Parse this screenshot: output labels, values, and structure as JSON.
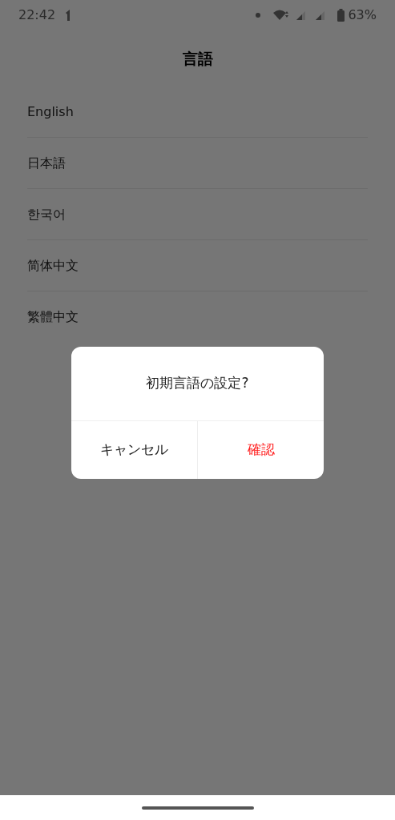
{
  "status_bar": {
    "time": "22:42",
    "battery": "63%"
  },
  "title": "言語",
  "languages": [
    "English",
    "日本語",
    "한국어",
    "简体中文",
    "繁體中文"
  ],
  "dialog": {
    "message": "初期言語の設定?",
    "buttons": [
      {
        "label": "キャンセル",
        "kind": "cancel"
      },
      {
        "label": "確認",
        "kind": "confirm"
      }
    ]
  }
}
